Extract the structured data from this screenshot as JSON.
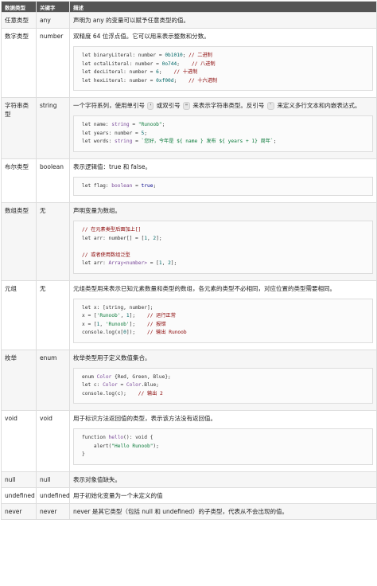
{
  "headers": [
    "数据类型",
    "关键字",
    "描述"
  ],
  "rows": [
    {
      "type": "任意类型",
      "keyword": "any",
      "desc": "声明为 any 的变量可以赋予任意类型的值。",
      "code": []
    },
    {
      "type": "数字类型",
      "keyword": "number",
      "desc": "双精度 64 位浮点值。它可以用来表示整数和分数。",
      "code": [
        [
          {
            "t": "let binaryLiteral: number = "
          },
          {
            "t": "0b1010",
            "c": "num"
          },
          {
            "t": "; "
          },
          {
            "t": "// 二进制",
            "c": "comment"
          }
        ],
        [
          {
            "t": "let octalLiteral: number = "
          },
          {
            "t": "0o744",
            "c": "num"
          },
          {
            "t": ";    "
          },
          {
            "t": "// 八进制",
            "c": "comment"
          }
        ],
        [
          {
            "t": "let decLiteral: number = "
          },
          {
            "t": "6",
            "c": "num"
          },
          {
            "t": ";    "
          },
          {
            "t": "// 十进制",
            "c": "comment"
          }
        ],
        [
          {
            "t": "let hexLiteral: number = "
          },
          {
            "t": "0xf00d",
            "c": "num"
          },
          {
            "t": ";    "
          },
          {
            "t": "// 十六进制",
            "c": "comment"
          }
        ]
      ]
    },
    {
      "type": "字符串类型",
      "keyword": "string",
      "desc_parts": [
        {
          "t": "一个字符系列，使用单引号 "
        },
        {
          "t": "'",
          "tick": true
        },
        {
          "t": " 或双引号 "
        },
        {
          "t": "\"",
          "tick": true
        },
        {
          "t": " 来表示字符串类型。反引号 "
        },
        {
          "t": "`",
          "tick": true
        },
        {
          "t": " 来定义多行文本和内嵌表达式。"
        }
      ],
      "code": [
        [
          {
            "t": "let name: "
          },
          {
            "t": "string",
            "c": "type"
          },
          {
            "t": " = "
          },
          {
            "t": "\"Runoob\"",
            "c": "str"
          },
          {
            "t": ";"
          }
        ],
        [
          {
            "t": "let years: number = "
          },
          {
            "t": "5",
            "c": "num"
          },
          {
            "t": ";"
          }
        ],
        [
          {
            "t": "let words: "
          },
          {
            "t": "string",
            "c": "type"
          },
          {
            "t": " = "
          },
          {
            "t": "`您好，今年是 ${ name } 发布 ${ years + 1} 周年`",
            "c": "str"
          },
          {
            "t": ";"
          }
        ]
      ]
    },
    {
      "type": "布尔类型",
      "keyword": "boolean",
      "desc": "表示逻辑值：true 和 false。",
      "code": [
        [
          {
            "t": "let flag: "
          },
          {
            "t": "boolean",
            "c": "type"
          },
          {
            "t": " = "
          },
          {
            "t": "true",
            "c": "kw"
          },
          {
            "t": ";"
          }
        ]
      ]
    },
    {
      "type": "数组类型",
      "keyword": "无",
      "desc": "声明变量为数组。",
      "code": [
        [
          {
            "t": "// 在元素类型后面加上[]",
            "c": "comment"
          }
        ],
        [
          {
            "t": "let arr: number[] = ["
          },
          {
            "t": "1",
            "c": "num"
          },
          {
            "t": ", "
          },
          {
            "t": "2",
            "c": "num"
          },
          {
            "t": "];"
          }
        ],
        [],
        [
          {
            "t": "// 或者使用数组泛型",
            "c": "comment"
          }
        ],
        [
          {
            "t": "let arr: "
          },
          {
            "t": "Array<number>",
            "c": "type"
          },
          {
            "t": " = ["
          },
          {
            "t": "1",
            "c": "num"
          },
          {
            "t": ", "
          },
          {
            "t": "2",
            "c": "num"
          },
          {
            "t": "];"
          }
        ]
      ]
    },
    {
      "type": "元组",
      "keyword": "无",
      "desc": "元组类型用来表示已知元素数量和类型的数组，各元素的类型不必相同，对应位置的类型需要相同。",
      "code": [
        [
          {
            "t": "let x: [string, number];"
          }
        ],
        [
          {
            "t": "x = ["
          },
          {
            "t": "'Runoob'",
            "c": "str"
          },
          {
            "t": ", "
          },
          {
            "t": "1",
            "c": "num"
          },
          {
            "t": "];    "
          },
          {
            "t": "// 运行正常",
            "c": "comment"
          }
        ],
        [
          {
            "t": "x = ["
          },
          {
            "t": "1",
            "c": "num"
          },
          {
            "t": ", "
          },
          {
            "t": "'Runoob'",
            "c": "str"
          },
          {
            "t": "];    "
          },
          {
            "t": "// 报错",
            "c": "comment"
          }
        ],
        [
          {
            "t": "console.log(x["
          },
          {
            "t": "0",
            "c": "num"
          },
          {
            "t": "]);    "
          },
          {
            "t": "// 输出 Runoob",
            "c": "comment"
          }
        ]
      ]
    },
    {
      "type": "枚举",
      "keyword": "enum",
      "desc": "枚举类型用于定义数值集合。",
      "code": [
        [
          {
            "t": "enum "
          },
          {
            "t": "Color",
            "c": "type"
          },
          {
            "t": " {Red, Green, Blue};"
          }
        ],
        [
          {
            "t": "let c: "
          },
          {
            "t": "Color",
            "c": "type"
          },
          {
            "t": " = "
          },
          {
            "t": "Color",
            "c": "type"
          },
          {
            "t": ".Blue;"
          }
        ],
        [
          {
            "t": "console.log(c);    "
          },
          {
            "t": "// 输出 2",
            "c": "comment"
          }
        ]
      ]
    },
    {
      "type": "void",
      "keyword": "void",
      "desc": "用于标识方法返回值的类型，表示该方法没有返回值。",
      "code": [
        [
          {
            "t": "function "
          },
          {
            "t": "hello",
            "c": "type"
          },
          {
            "t": "(): void {"
          }
        ],
        [
          {
            "t": "    alert("
          },
          {
            "t": "\"Hello Runoob\"",
            "c": "str"
          },
          {
            "t": ");"
          }
        ],
        [
          {
            "t": "}"
          }
        ]
      ]
    },
    {
      "type": "null",
      "keyword": "null",
      "desc": "表示对象值缺失。",
      "code": []
    },
    {
      "type": "undefined",
      "keyword": "undefined",
      "desc": "用于初始化变量为一个未定义的值",
      "code": []
    },
    {
      "type": "never",
      "keyword": "never",
      "desc": "never 是其它类型（包括 null 和 undefined）的子类型，代表从不会出现的值。",
      "code": []
    }
  ]
}
